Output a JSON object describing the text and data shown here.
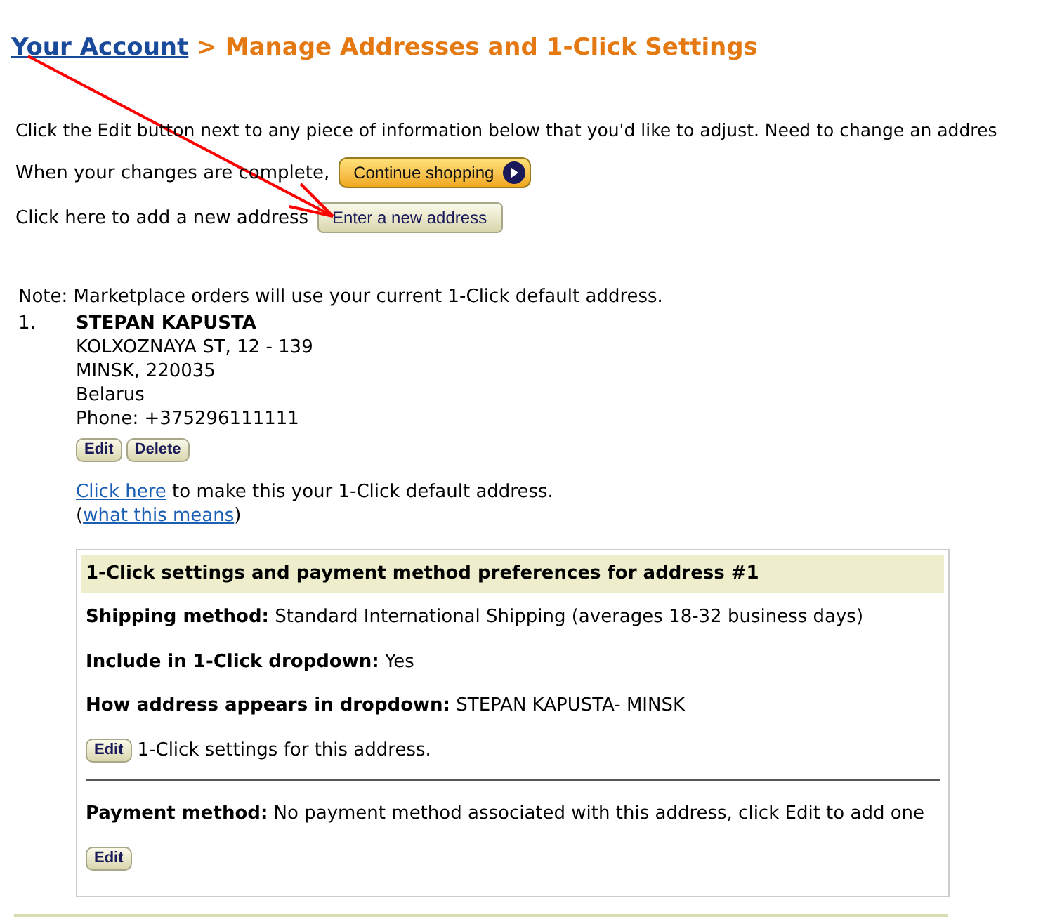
{
  "breadcrumb": {
    "link": "Your Account",
    "separator": ">",
    "title": "Manage Addresses and 1-Click Settings"
  },
  "intro": "Click the Edit button next to any piece of information below that you'd like to adjust. Need to change an addres",
  "continue_row": {
    "text": "When your changes are complete,",
    "button": "Continue shopping"
  },
  "new_address_row": {
    "text": "Click here to add a new address",
    "button": "Enter a new address"
  },
  "note": "Note: Marketplace orders will use your current 1-Click default address.",
  "addresses": [
    {
      "number": "1.",
      "name": "STEPAN KAPUSTA",
      "lines": [
        "KOLXOZNAYA ST, 12 - 139",
        "MINSK, 220035",
        "Belarus",
        "Phone: +375296111111"
      ],
      "buttons": [
        "Edit",
        "Delete"
      ],
      "default_link": "Click here",
      "default_text": "to make this your 1-Click default address.",
      "means_open": "(",
      "means_link": "what this means",
      "means_close": ")",
      "settings": {
        "title": "1-Click settings and payment method preferences for address #1",
        "fields": [
          {
            "label": "Shipping method:",
            "value": "Standard International Shipping (averages 18-32 business days)"
          },
          {
            "label": "Include in 1-Click dropdown:",
            "value": "Yes"
          },
          {
            "label": "How address appears in dropdown:",
            "value": "STEPAN KAPUSTA- MINSK"
          }
        ],
        "edit_button": "Edit",
        "edit_text": "1-Click settings for this address.",
        "payment_label": "Payment method:",
        "payment_value": "No payment method associated with this address, click Edit to add one",
        "payment_button": "Edit"
      }
    }
  ]
}
